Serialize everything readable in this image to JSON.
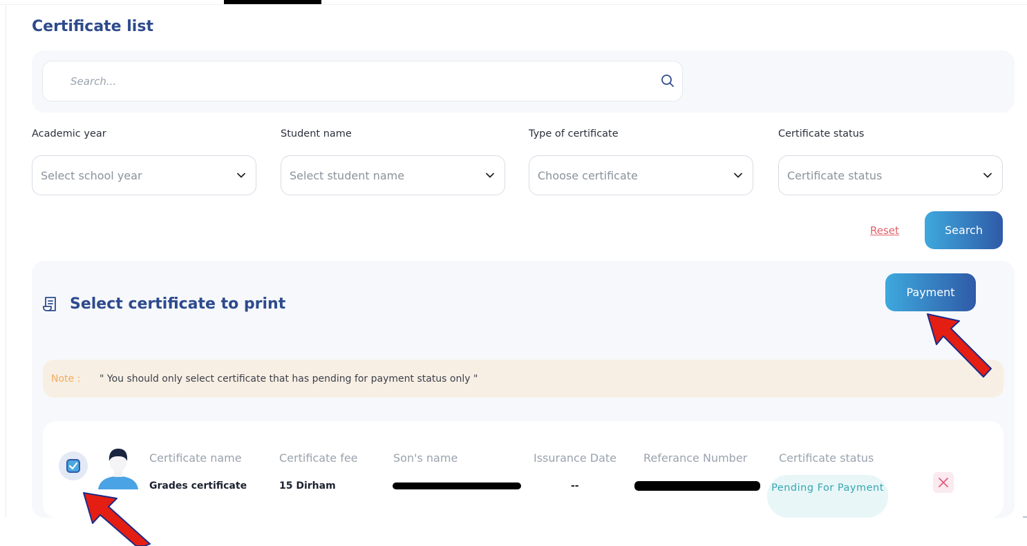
{
  "page": {
    "title": "Certificate list"
  },
  "search": {
    "placeholder": "Search..."
  },
  "filters": [
    {
      "label": "Academic year",
      "placeholder": "Select school year"
    },
    {
      "label": "Student name",
      "placeholder": "Select student name"
    },
    {
      "label": "Type of certificate",
      "placeholder": "Choose certificate"
    },
    {
      "label": "Certificate status",
      "placeholder": "Certificate status"
    }
  ],
  "actions": {
    "reset": "Reset",
    "search": "Search",
    "payment": "Payment"
  },
  "section": {
    "title": "Select certificate to print",
    "icon": "receipt-icon"
  },
  "note": {
    "prefix": "Note :",
    "text": "\" You should only select certificate that has pending for payment status only \""
  },
  "table": {
    "headers": [
      "Certificate name",
      "Certificate fee",
      "Son's name",
      "Issurance Date",
      "Referance Number",
      "Certificate status"
    ],
    "rows": [
      {
        "selected": true,
        "certificate_name": "Grades certificate",
        "certificate_fee": "15 Dirham",
        "issuance_date": "--",
        "status": "Pending For Payment"
      }
    ]
  },
  "colors": {
    "primary": "#2d4a8c",
    "accent": "#3ea9dd",
    "danger": "#e0606b",
    "status": "#37a6b1",
    "annotation_arrow": "#e41e12"
  }
}
